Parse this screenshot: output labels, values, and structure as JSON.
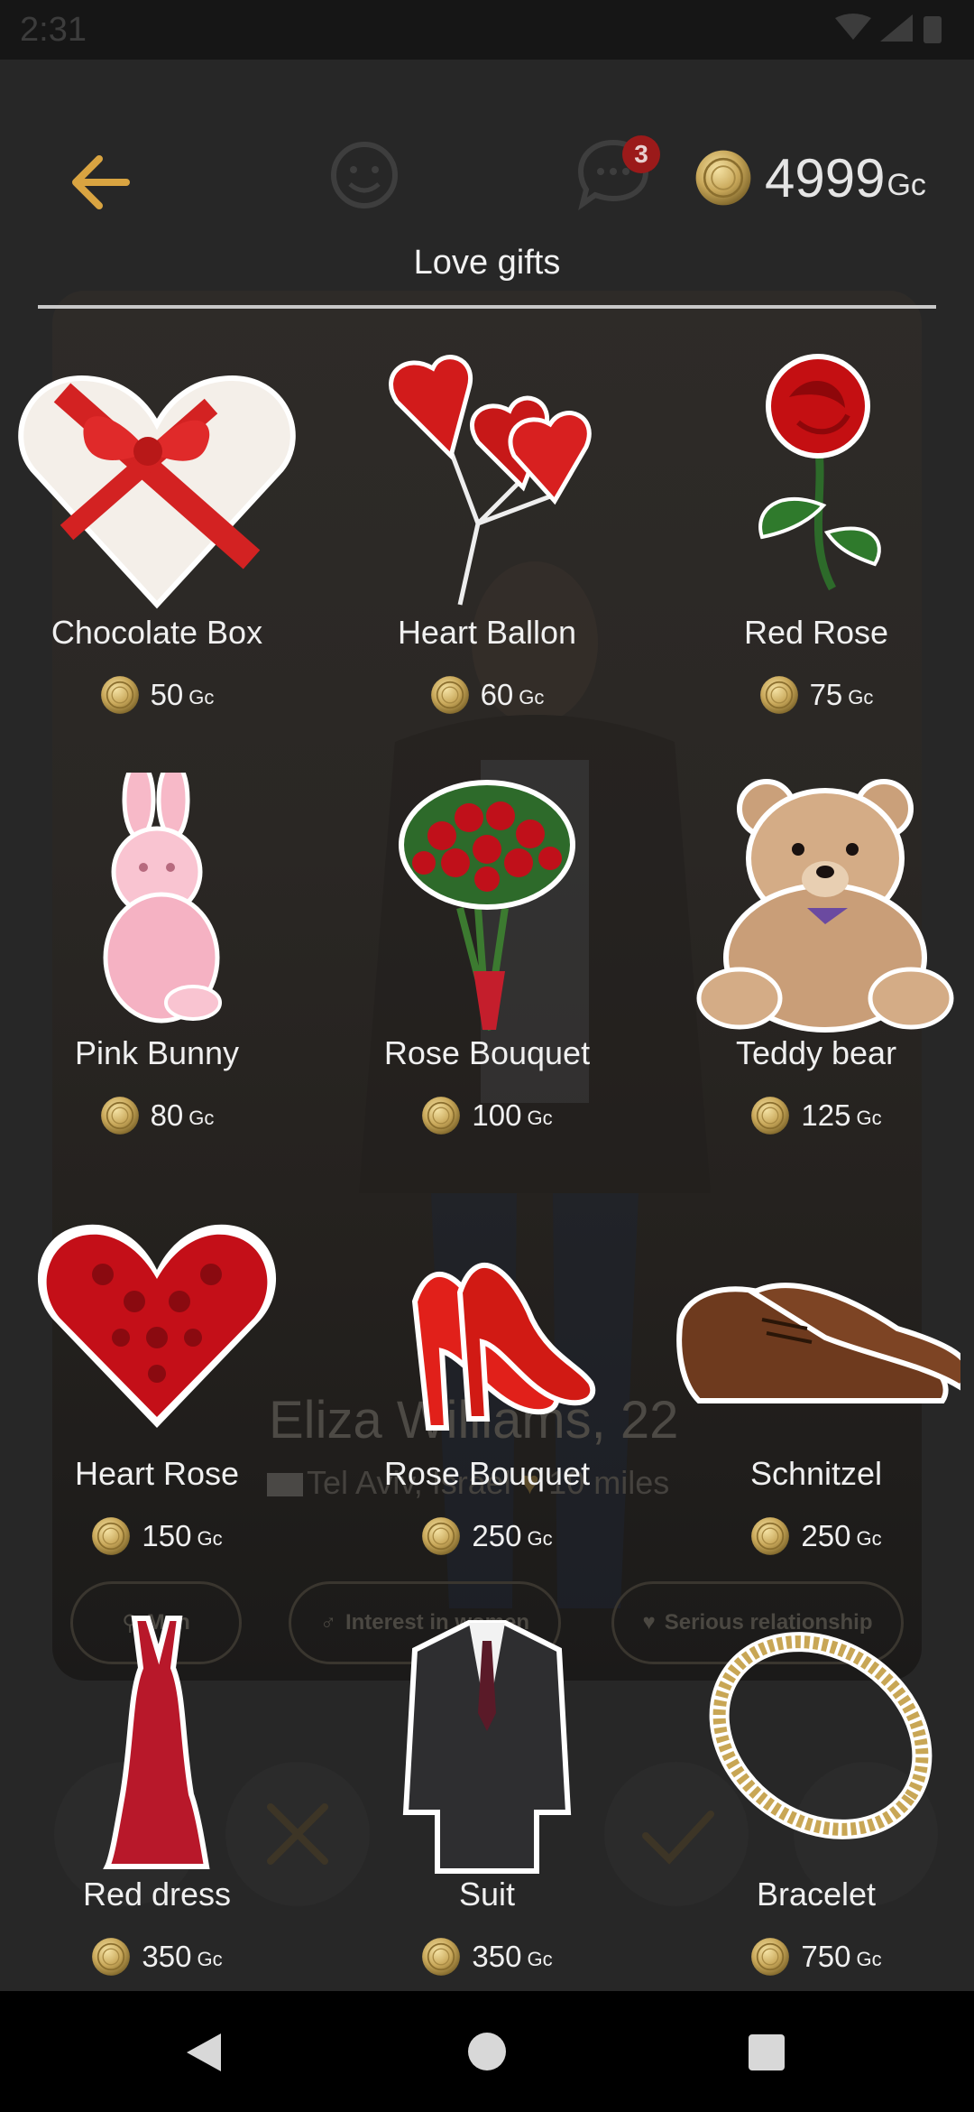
{
  "status_bar": {
    "time": "2:31"
  },
  "header": {
    "balance_amount": "4999",
    "balance_unit": "Gc",
    "chat_badge_count": "3",
    "section_title": "Love gifts"
  },
  "profile": {
    "name": "Eliza Williams, 22",
    "location": "Tel Aviv, Israel",
    "distance": "10 miles",
    "tags": [
      "Man",
      "Interest in women",
      "Serious relationship"
    ]
  },
  "gifts": [
    {
      "name": "Chocolate Box",
      "price": "50",
      "unit": "Gc",
      "icon": "chocolate-box-icon"
    },
    {
      "name": "Heart Ballon",
      "price": "60",
      "unit": "Gc",
      "icon": "heart-balloon-icon"
    },
    {
      "name": "Red Rose",
      "price": "75",
      "unit": "Gc",
      "icon": "red-rose-icon"
    },
    {
      "name": "Pink Bunny",
      "price": "80",
      "unit": "Gc",
      "icon": "pink-bunny-icon"
    },
    {
      "name": "Rose Bouquet",
      "price": "100",
      "unit": "Gc",
      "icon": "rose-bouquet-icon"
    },
    {
      "name": "Teddy bear",
      "price": "125",
      "unit": "Gc",
      "icon": "teddy-bear-icon"
    },
    {
      "name": "Heart Rose",
      "price": "150",
      "unit": "Gc",
      "icon": "heart-rose-icon"
    },
    {
      "name": "Rose Bouquet",
      "price": "250",
      "unit": "Gc",
      "icon": "red-heels-icon"
    },
    {
      "name": "Schnitzel",
      "price": "250",
      "unit": "Gc",
      "icon": "brown-shoes-icon"
    },
    {
      "name": "Red dress",
      "price": "350",
      "unit": "Gc",
      "icon": "red-dress-icon"
    },
    {
      "name": "Suit",
      "price": "350",
      "unit": "Gc",
      "icon": "suit-icon"
    },
    {
      "name": "Bracelet",
      "price": "750",
      "unit": "Gc",
      "icon": "bracelet-icon"
    }
  ],
  "colors": {
    "accent_gold": "#d9a441",
    "background": "#272727",
    "text": "#f0f0f0",
    "badge": "#9b1a1a"
  }
}
